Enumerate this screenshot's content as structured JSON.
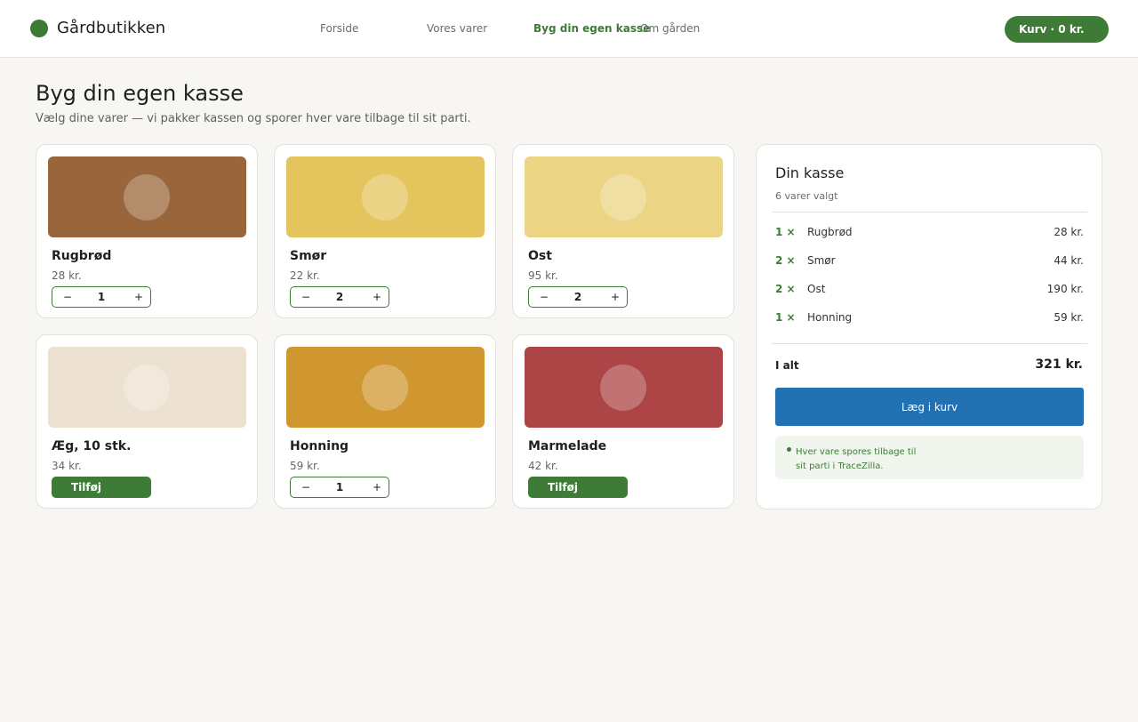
{
  "brand": {
    "name": "Gårdbutikken",
    "color": "#3e7b37"
  },
  "nav": {
    "items": [
      {
        "label": "Forside"
      },
      {
        "label": "Vores varer"
      },
      {
        "label": "Byg din egen kasse"
      },
      {
        "label": "Om gården"
      }
    ],
    "active": "Byg din egen kasse"
  },
  "cart_button": {
    "label": "Kurv · 0 kr."
  },
  "page": {
    "title": "Byg din egen kasse",
    "subtitle": "Vælg dine varer — vi pakker kassen og sporer hver vare tilbage til sit parti."
  },
  "products": [
    {
      "name": "Rugbrød",
      "price": "28 kr.",
      "color": "#98663a",
      "quantity": "1",
      "state": "stepper"
    },
    {
      "name": "Smør",
      "price": "22 kr.",
      "color": "#e3c45d",
      "quantity": "2",
      "state": "stepper"
    },
    {
      "name": "Ost",
      "price": "95 kr.",
      "color": "#ebd584",
      "quantity": "2",
      "state": "stepper"
    },
    {
      "name": "Æg, 10 stk.",
      "price": "34 kr.",
      "color": "#ede2d1",
      "add_label": "Tilføj",
      "state": "add"
    },
    {
      "name": "Honning",
      "price": "59 kr.",
      "color": "#d09731",
      "quantity": "1",
      "state": "stepper"
    },
    {
      "name": "Marmelade",
      "price": "42 kr.",
      "color": "#ad4446",
      "add_label": "Tilføj",
      "state": "add"
    }
  ],
  "stepper": {
    "minus": "−",
    "plus": "+"
  },
  "summary": {
    "title": "Din kasse",
    "count": "6 varer valgt",
    "lines": [
      {
        "qty": "1 ×",
        "name": "Rugbrød",
        "total": "28 kr."
      },
      {
        "qty": "2 ×",
        "name": "Smør",
        "total": "44 kr."
      },
      {
        "qty": "2 ×",
        "name": "Ost",
        "total": "190 kr."
      },
      {
        "qty": "1 ×",
        "name": "Honning",
        "total": "59 kr."
      }
    ],
    "total_label": "I alt",
    "total_value": "321 kr.",
    "checkout_label": "Læg i kurv",
    "checkout_color": "#2271b3",
    "note": "Hver vare spores tilbage til sit parti i TraceZilla."
  }
}
